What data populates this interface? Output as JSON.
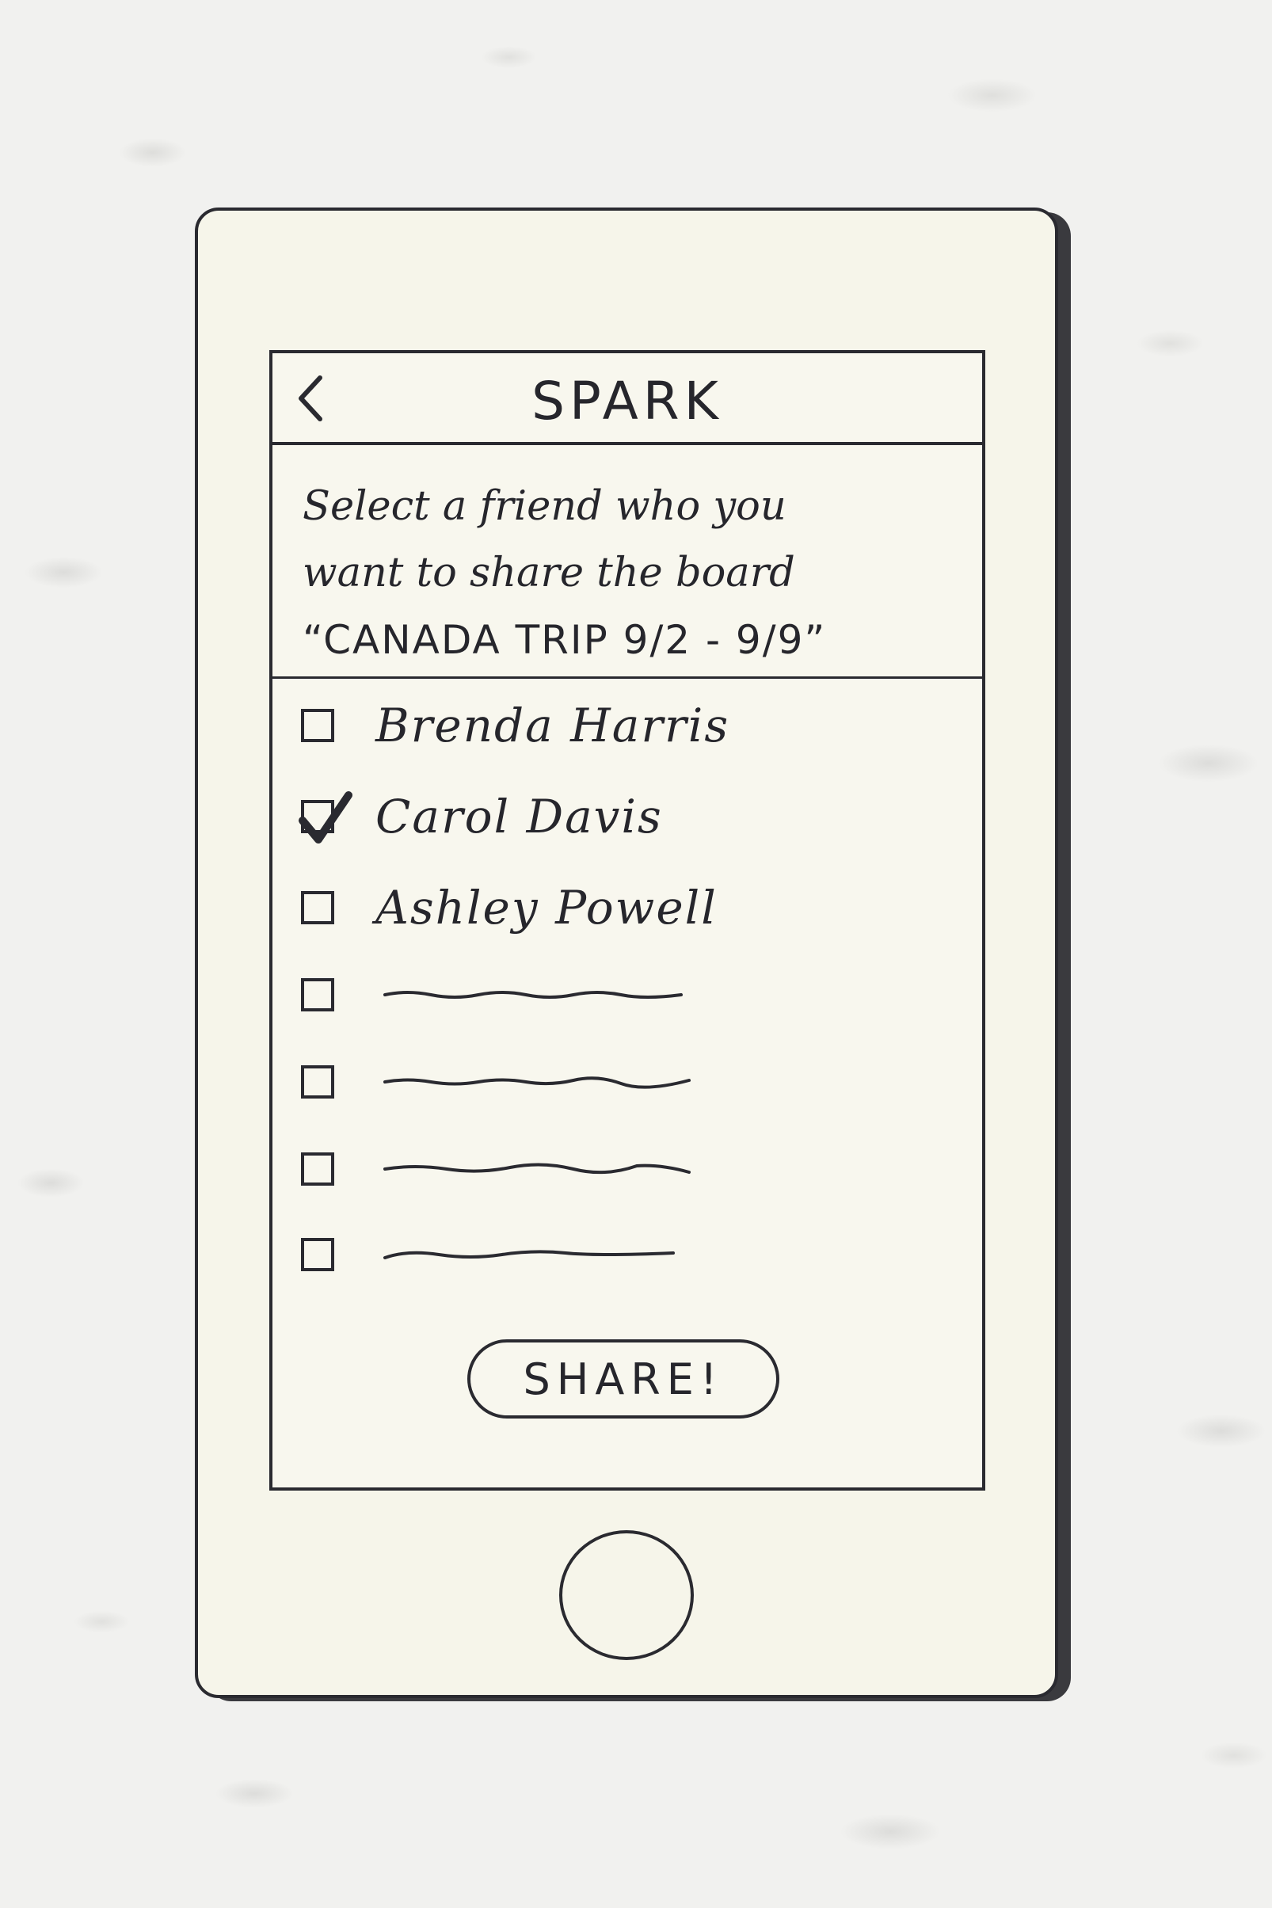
{
  "app": {
    "title": "SPARK",
    "back_icon": "chevron-left-icon"
  },
  "instruction": {
    "line1": "Select a friend who you",
    "line2": "want to share the board",
    "line3": "“CANADA TRIP 9/2 - 9/9”"
  },
  "friends": [
    {
      "name": "Brenda Harris",
      "checked": false
    },
    {
      "name": "Carol Davis",
      "checked": true
    },
    {
      "name": "Ashley Powell",
      "checked": false
    },
    {
      "name": "",
      "checked": false
    },
    {
      "name": "",
      "checked": false
    },
    {
      "name": "",
      "checked": false
    },
    {
      "name": "",
      "checked": false
    }
  ],
  "share_button": {
    "label": "SHARE!"
  },
  "colors": {
    "ink": "#2a2a30",
    "paper": "#f6f5ea",
    "background": "#f1f1ef"
  }
}
